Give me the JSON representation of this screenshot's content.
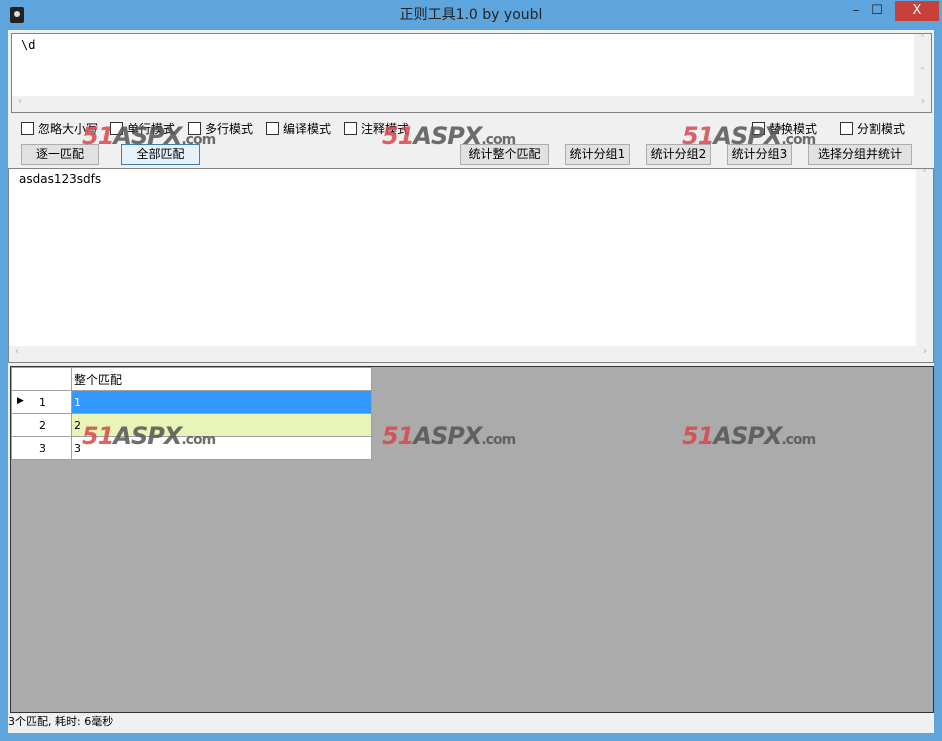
{
  "window": {
    "title": "正则工具1.0 by youbl",
    "minimize": "–",
    "maximize": "☐",
    "close": "X"
  },
  "regex": {
    "value": "\\d"
  },
  "options": [
    {
      "label": "忽略大小写",
      "checked": false
    },
    {
      "label": "单行模式",
      "checked": false
    },
    {
      "label": "多行模式",
      "checked": false
    },
    {
      "label": "编译模式",
      "checked": false
    },
    {
      "label": "注释模式",
      "checked": false
    },
    {
      "label": "替换模式",
      "checked": false
    },
    {
      "label": "分割模式",
      "checked": false
    }
  ],
  "buttons": {
    "match_next": "逐一匹配",
    "match_all": "全部匹配",
    "count_whole": "统计整个匹配",
    "count_g1": "统计分组1",
    "count_g2": "统计分组2",
    "count_g3": "统计分组3",
    "select_group": "选择分组并统计"
  },
  "input": {
    "value": "asdas123sdfs"
  },
  "grid": {
    "header": "整个匹配",
    "rows": [
      {
        "num": "1",
        "value": "1"
      },
      {
        "num": "2",
        "value": "2"
      },
      {
        "num": "3",
        "value": "3"
      }
    ]
  },
  "status": "3个匹配, 耗时: 6毫秒",
  "watermark": "51ASPX.com",
  "colors": {
    "selection": "#3399ff",
    "alt_row": "#e8f4b8",
    "grid_bg": "#ababab"
  }
}
